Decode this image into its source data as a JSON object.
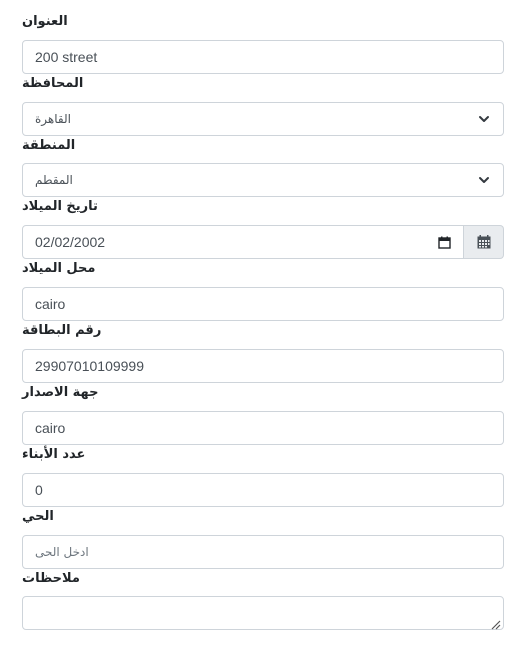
{
  "form": {
    "address": {
      "label": "العنوان",
      "value": "200 street"
    },
    "governorate": {
      "label": "المحافظة",
      "selected": "القاهرة"
    },
    "district": {
      "label": "المنطقة",
      "selected": "المقطم"
    },
    "birth_date": {
      "label": "تاريخ الميلاد",
      "value": "02/02/2002"
    },
    "birth_place": {
      "label": "محل الميلاد",
      "value": "cairo"
    },
    "id_number": {
      "label": "رقم البطاقة",
      "value": "29907010109999"
    },
    "issuer": {
      "label": "جهة الاصدار",
      "value": "cairo"
    },
    "children_count": {
      "label": "عدد الأبناء",
      "value": "0"
    },
    "neighborhood": {
      "label": "الحي",
      "placeholder": "ادخل الحى",
      "value": ""
    },
    "notes": {
      "label": "ملاحظات",
      "value": ""
    }
  },
  "icons": {
    "select_arrow": "chevron-down-icon",
    "date_picker": "calendar-icon",
    "addon_calendar": "calendar-grid-icon",
    "textarea_resize": "resize-grip-icon"
  },
  "colors": {
    "border": "#ced4da",
    "addon_bg": "#e9ecef",
    "text": "#212529",
    "placeholder": "#6c757d"
  }
}
